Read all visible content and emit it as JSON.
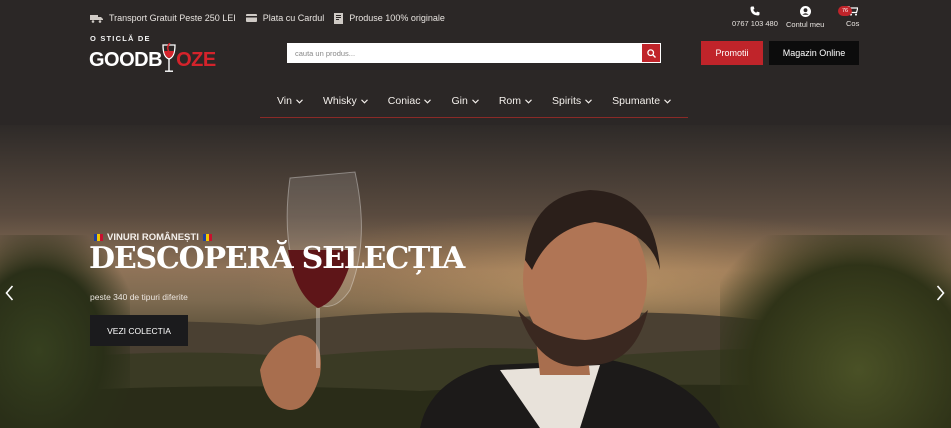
{
  "topbar": {
    "shipping": "Transport Gratuit Peste 250 LEI",
    "card": "Plata cu Cardul",
    "original": "Produse 100% originale"
  },
  "utility": {
    "phone": "0767 103 480",
    "account": "Contul meu",
    "cart": "Cos",
    "cart_count": "76"
  },
  "logo": {
    "tagline": "O STICLĂ DE",
    "brand_part1": "GOODB",
    "brand_part2": "OZE"
  },
  "search": {
    "placeholder": "cauta un produs..."
  },
  "buttons": {
    "promo": "Promotii",
    "shop": "Magazin Online"
  },
  "nav": {
    "items": [
      {
        "label": "Vin"
      },
      {
        "label": "Whisky"
      },
      {
        "label": "Coniac"
      },
      {
        "label": "Gin"
      },
      {
        "label": "Rom"
      },
      {
        "label": "Spirits"
      },
      {
        "label": "Spumante"
      }
    ]
  },
  "hero": {
    "kicker": "VINURI ROMÂNEȘTI",
    "headline": "DESCOPERĂ SELECȚIA",
    "subtitle": "peste 340 de tipuri diferite",
    "cta": "VEZI COLECTIA"
  },
  "colors": {
    "brand_red": "#c0242a",
    "header_bg": "#2b2726",
    "dark_button": "#0c0c0c"
  },
  "icons": [
    "truck-icon",
    "card-icon",
    "certificate-icon",
    "phone-icon",
    "user-icon",
    "cart-icon",
    "search-icon",
    "chevron-down-icon",
    "arrow-left-icon",
    "arrow-right-icon",
    "flag-icon"
  ]
}
